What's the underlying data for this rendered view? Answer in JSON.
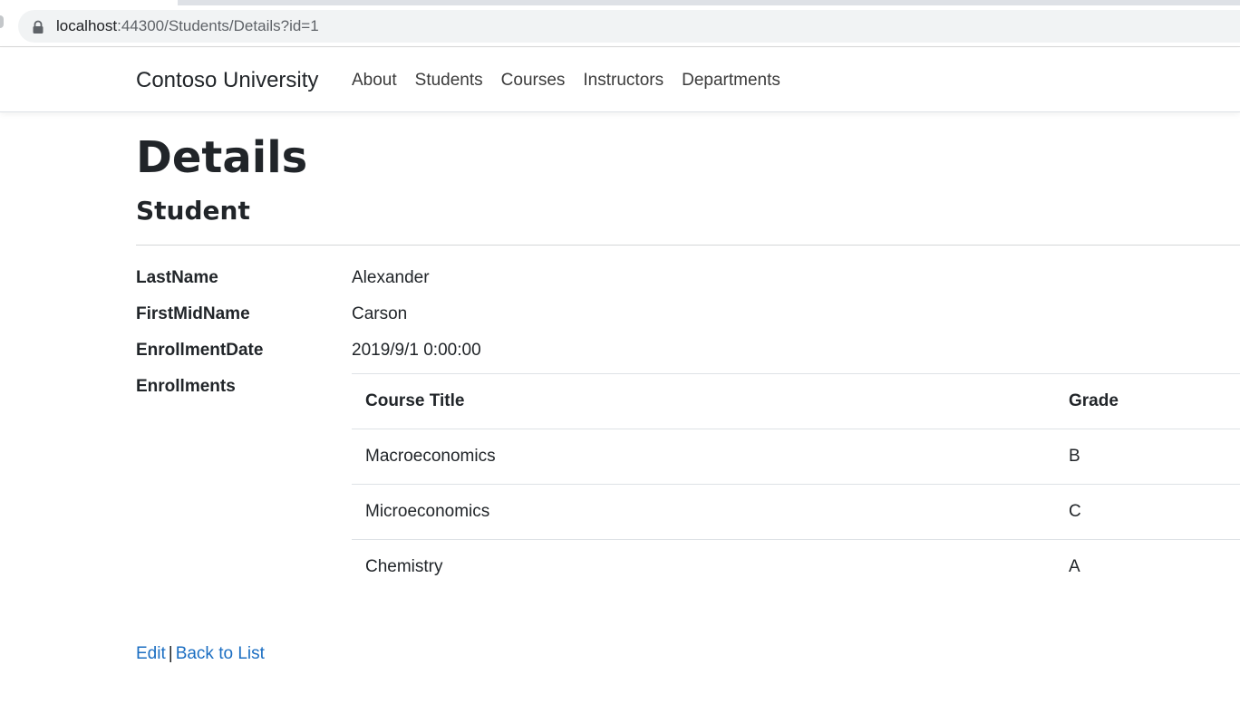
{
  "browser": {
    "url_host": "localhost",
    "url_rest": ":44300/Students/Details?id=1"
  },
  "navbar": {
    "brand": "Contoso University",
    "links": [
      "About",
      "Students",
      "Courses",
      "Instructors",
      "Departments"
    ]
  },
  "page": {
    "title": "Details",
    "subtitle": "Student"
  },
  "details": {
    "last_name_label": "LastName",
    "last_name_value": "Alexander",
    "first_mid_name_label": "FirstMidName",
    "first_mid_name_value": "Carson",
    "enrollment_date_label": "EnrollmentDate",
    "enrollment_date_value": "2019/9/1 0:00:00",
    "enrollments_label": "Enrollments"
  },
  "enrollments": {
    "headers": [
      "Course Title",
      "Grade"
    ],
    "rows": [
      [
        "Macroeconomics",
        "B"
      ],
      [
        "Microeconomics",
        "C"
      ],
      [
        "Chemistry",
        "A"
      ]
    ]
  },
  "actions": {
    "edit_label": "Edit",
    "separator": "|",
    "back_label": "Back to List"
  },
  "colors": {
    "link": "#1b6ec2",
    "text": "#212529",
    "omnibox": "#f1f3f4"
  },
  "icons": {
    "lock": "lock-icon"
  }
}
